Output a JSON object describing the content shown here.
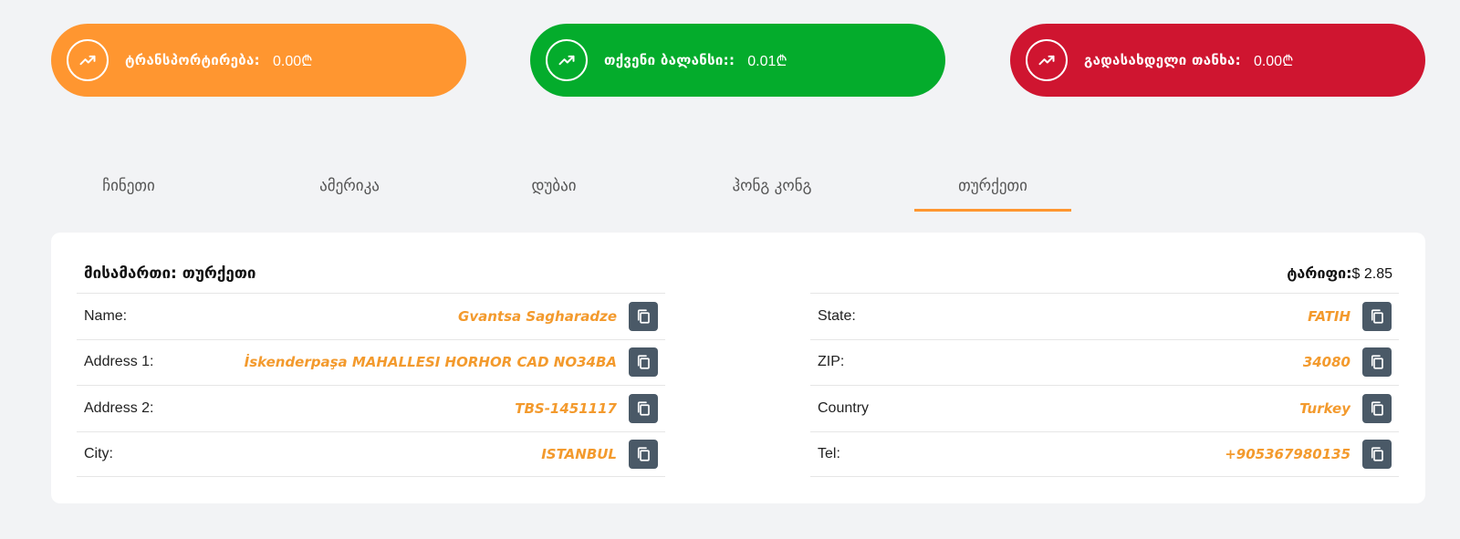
{
  "summary": {
    "transport": {
      "label": "ტრანსპორტირება:",
      "value": "0.00₾",
      "color": "#ff9630",
      "icon": "trending-up-icon"
    },
    "balance": {
      "label": "თქვენი ბალანსი::",
      "value": "0.01₾",
      "color": "#04ac2c",
      "icon": "trending-up-icon"
    },
    "payable": {
      "label": "გადასახდელი თანხა:",
      "value": "0.00₾",
      "color": "#cf1530",
      "icon": "trending-up-icon"
    }
  },
  "tabs": [
    {
      "label": "ჩინეთი",
      "active": false
    },
    {
      "label": "ამერიკა",
      "active": false
    },
    {
      "label": "დუბაი",
      "active": false
    },
    {
      "label": "ჰონგ კონგ",
      "active": false
    },
    {
      "label": "თურქეთი",
      "active": true
    }
  ],
  "address": {
    "title": "მისამართი: თურქეთი",
    "tariff_label": "ტარიფი:",
    "tariff_value": "$ 2.85",
    "left_fields": [
      {
        "key": "Name:",
        "value": "Gvantsa Sagharadze"
      },
      {
        "key": "Address 1:",
        "value": "İskenderpaşa MAHALLESI HORHOR CAD NO34BA"
      },
      {
        "key": "Address 2:",
        "value": "TBS-1451117"
      },
      {
        "key": "City:",
        "value": "ISTANBUL"
      }
    ],
    "right_fields": [
      {
        "key": "State:",
        "value": "FATIH"
      },
      {
        "key": "ZIP:",
        "value": "34080"
      },
      {
        "key": "Country",
        "value": "Turkey"
      },
      {
        "key": "Tel:",
        "value": "+905367980135"
      }
    ],
    "copy_icon": "copy-icon",
    "accent_color": "#f39a2d"
  }
}
